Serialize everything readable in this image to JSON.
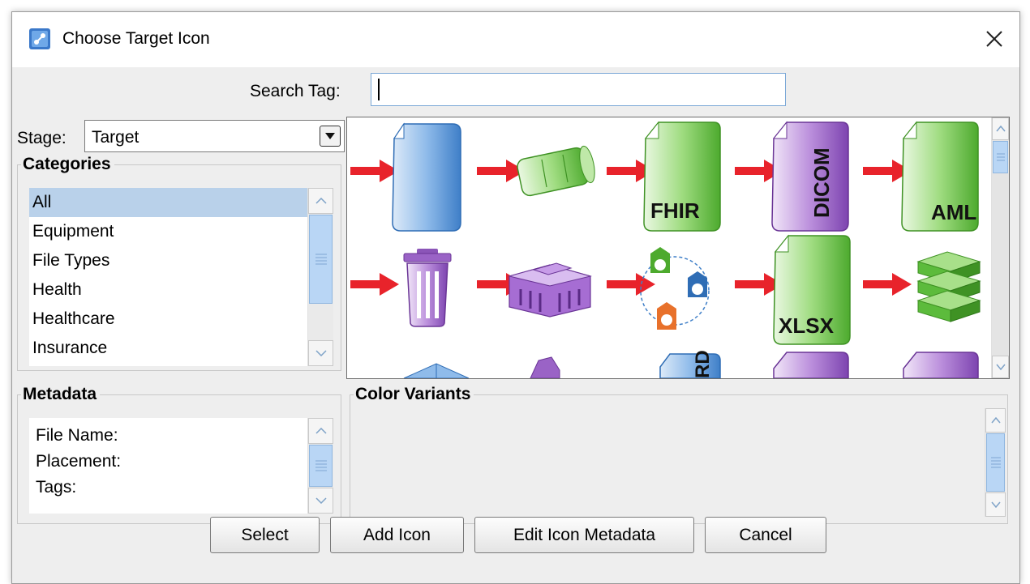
{
  "window": {
    "title": "Choose Target Icon"
  },
  "search": {
    "label": "Search Tag:",
    "value": ""
  },
  "stage": {
    "label": "Stage:",
    "value": "Target"
  },
  "categories": {
    "title": "Categories",
    "items": [
      {
        "label": "All",
        "selected": true
      },
      {
        "label": "Equipment",
        "selected": false
      },
      {
        "label": "File Types",
        "selected": false
      },
      {
        "label": "Health",
        "selected": false
      },
      {
        "label": "Healthcare",
        "selected": false
      },
      {
        "label": "Insurance",
        "selected": false
      }
    ]
  },
  "icons": {
    "row1": [
      "document-target-icon",
      "database-cylinder-target-icon",
      "fhir-file-target-icon",
      "dicom-file-target-icon",
      "aml-file-target-icon"
    ],
    "row2": [
      "trash-bin-target-icon",
      "hospital-building-target-icon",
      "lab-flask-network-target-icon",
      "xlsx-file-target-icon",
      "server-stack-target-icon"
    ],
    "labels": {
      "fhir": "FHIR",
      "dicom": "DICOM",
      "aml": "AML",
      "xlsx": "XLSX",
      "partial": "RD"
    }
  },
  "metadata": {
    "title": "Metadata",
    "file_name_label": "File Name:",
    "placement_label": "Placement:",
    "tags_label": "Tags:"
  },
  "color_variants": {
    "title": "Color Variants"
  },
  "buttons": {
    "select": "Select",
    "add_icon": "Add Icon",
    "edit_metadata": "Edit Icon Metadata",
    "cancel": "Cancel"
  },
  "colors": {
    "accent_blue": "#4f8fd6",
    "green": "#5cbb3c",
    "purple": "#9058c0",
    "arrow_red": "#e8232b",
    "selection": "#b9d1ea"
  }
}
